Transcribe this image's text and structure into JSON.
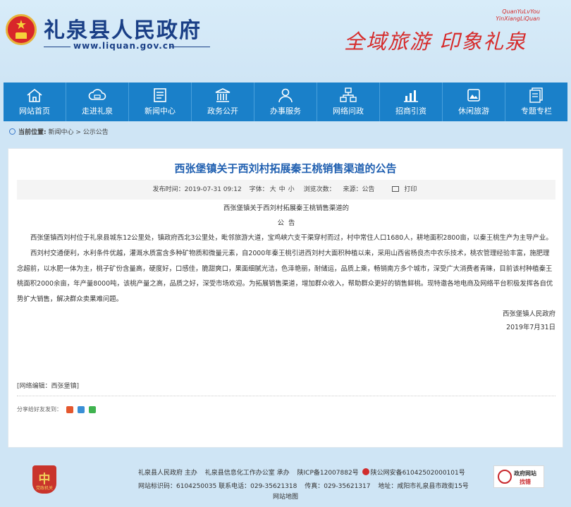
{
  "header": {
    "site_title": "礼泉县人民政府",
    "site_url": "www.liquan.gov.cn",
    "slogan_pinyin_1": "QuanYuLvYou",
    "slogan_pinyin_2": "YinXiangLiQuan",
    "slogan": "全域旅游 印象礼泉"
  },
  "nav": {
    "items": [
      {
        "label": "网站首页",
        "icon": "home-icon"
      },
      {
        "label": "走进礼泉",
        "icon": "cloud-icon"
      },
      {
        "label": "新闻中心",
        "icon": "news-icon"
      },
      {
        "label": "政务公开",
        "icon": "building-icon"
      },
      {
        "label": "办事服务",
        "icon": "user-service-icon"
      },
      {
        "label": "网络问政",
        "icon": "network-icon"
      },
      {
        "label": "招商引资",
        "icon": "chart-icon"
      },
      {
        "label": "休闲旅游",
        "icon": "travel-icon"
      },
      {
        "label": "专题专栏",
        "icon": "topic-icon"
      }
    ]
  },
  "breadcrumb": {
    "prefix": "当前位置:",
    "level1": "新闻中心",
    "separator": ">",
    "level2": "公示公告"
  },
  "article": {
    "title": "西张堡镇关于西刘村拓展秦王桃销售渠道的公告",
    "meta": {
      "publish": "发布时间：2019-07-31 09:12",
      "font_label": "字体：",
      "font_large": "大",
      "font_medium": "中",
      "font_small": "小",
      "views": "浏览次数：",
      "source": "来源：公告",
      "print": "打印"
    },
    "subtitle": "西张堡镇关于西刘村拓展秦王桃销售渠道的",
    "notice": "公  告",
    "paragraphs": [
      "西张堡镇西刘村位于礼泉县城东12公里处，镇政府西北3公里处，毗邻旅游大道，宝鸡峡六支干渠穿村而过，村中常住人口1680人，耕地面积2800亩，以秦王桃生产为主导产业。",
      "西刘村交通便利，水利条件优越，灌溉水质富含多种矿物质和微量元素，自2000年秦王桃引进西刘村大面积种植以来，采用山西省杨良杰中农乐技术，桃农管理经验丰富，施肥理念超前，以水肥一体为主，桃子矿份含量高，硬度好，口感佳，脆甜爽口，果面细腻光洁，色泽艳丽，耐储运，品质上乘，畅销南方多个城市，深受广大消费者青睐，目前该村种植秦王桃面积2000余亩，年产量8000吨，该桃产量之高，品质之好，深受市场欢迎。为拓展销售渠道，增加群众收入，帮助群众更好的销售鲜桃。现特邀各地电商及网络平台积极发挥各自优势扩大销售，解决群众卖果难问题。"
    ],
    "signature": "西张堡镇人民政府",
    "date": "2019年7月31日",
    "editor": "[网络编辑：西张堡镇]",
    "share_label": "分享给好友发到："
  },
  "footer": {
    "badge_char": "中",
    "badge_text": "党政机关",
    "line1_a": "礼泉县人民政府 主办",
    "line1_b": "礼泉县信息化工作办公室 承办",
    "line1_c": "陕ICP备12007882号",
    "line1_d": "陕公网安备61042502000101号",
    "line2_a": "网站标识码：6104250035 联系电话：029-35621318",
    "line2_b": "传真：029-35621317",
    "line2_c": "地址：咸阳市礼泉县市政街15号",
    "sitemap": "网站地图",
    "jiucuo_t1": "政府网站",
    "jiucuo_t2": "找错"
  },
  "colors": {
    "nav_bg": "#1a80c9",
    "title_blue": "#1f5fb0",
    "header_blue": "#1a3f86",
    "slogan_red": "#d62b2b",
    "page_bg": "#cfe5f5"
  }
}
